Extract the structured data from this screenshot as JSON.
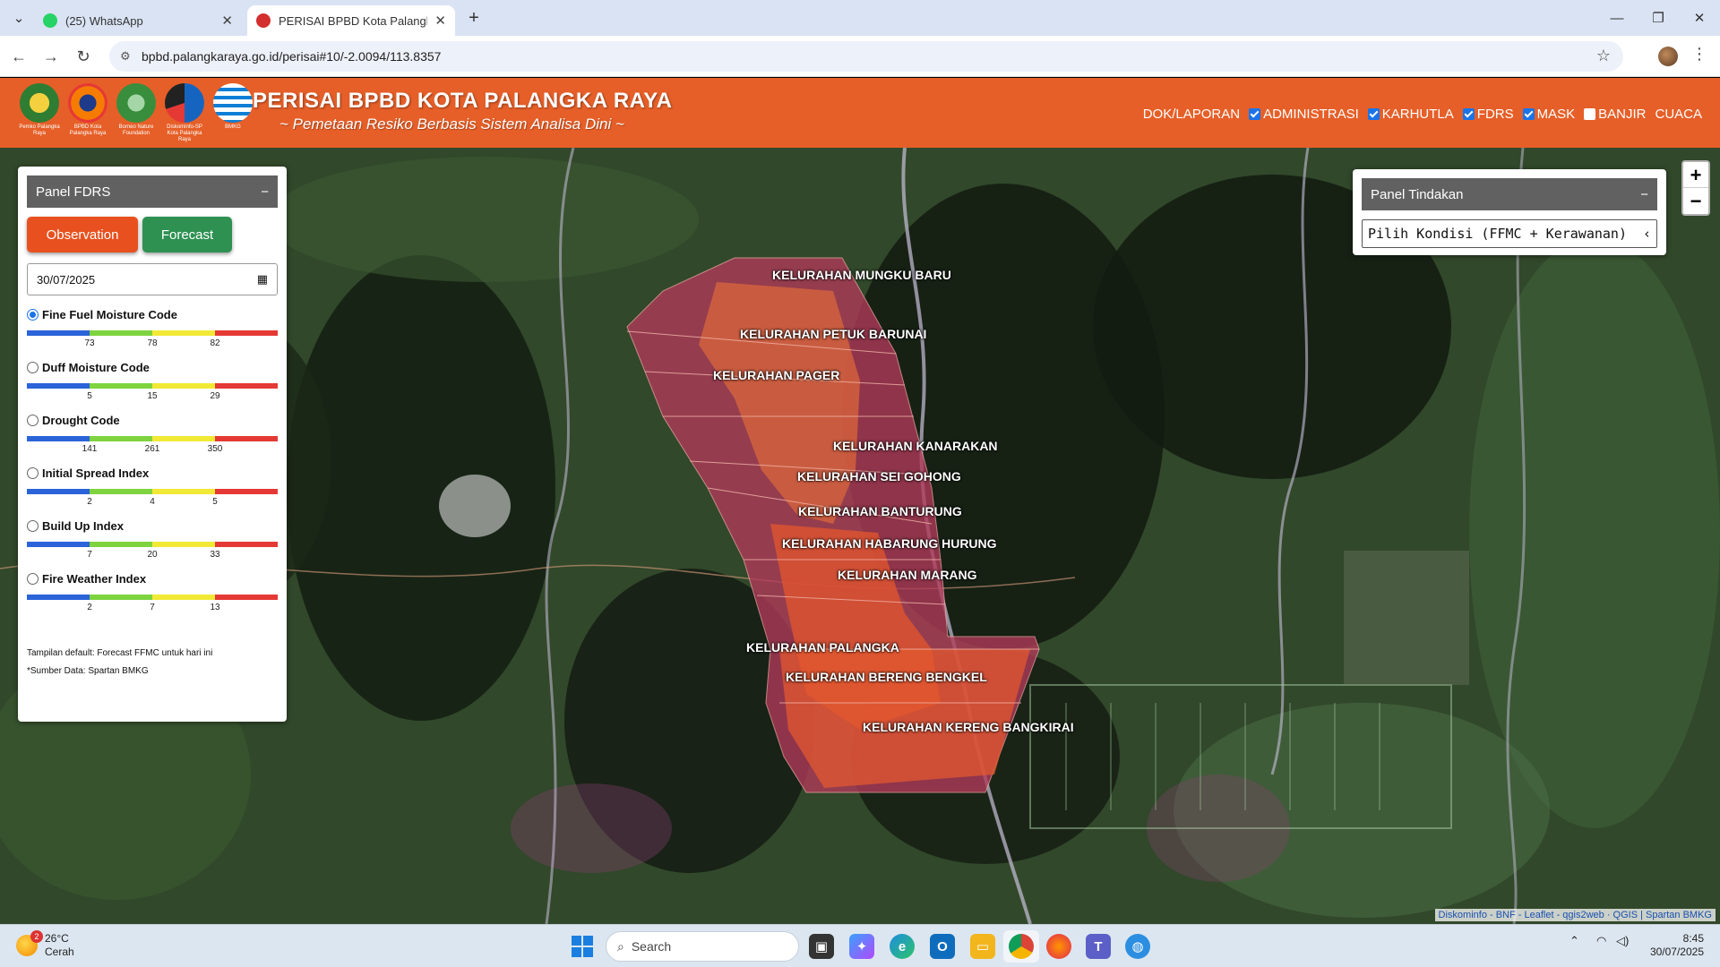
{
  "browser": {
    "tabs": [
      {
        "title": "(25) WhatsApp",
        "active": false
      },
      {
        "title": "PERISAI BPBD Kota Palangka Raya",
        "active": true
      }
    ],
    "url": "bpbd.palangkaraya.go.id/perisai#10/-2.0094/113.8357"
  },
  "header": {
    "logos": [
      {
        "caption": "Pemko Palangka Raya",
        "color": "#2e7d32"
      },
      {
        "caption": "BPBD Kota Palangka Raya",
        "color": "#e53935"
      },
      {
        "caption": "Borneo Nature Foundation",
        "color": "#388e3c"
      },
      {
        "caption": "Diskominfo-SP Kota Palangka Raya",
        "color": "#1565c0"
      },
      {
        "caption": "BMKG",
        "color": "#0d7fd6"
      }
    ],
    "title": "PERISAI BPBD KOTA PALANGKA RAYA",
    "subtitle": "~ Pemetaan Resiko Berbasis Sistem Analisa Dini ~",
    "menu": [
      {
        "label": "DOK/LAPORAN",
        "checkbox": false
      },
      {
        "label": "ADMINISTRASI",
        "checkbox": true,
        "checked": true
      },
      {
        "label": "KARHUTLA",
        "checkbox": true,
        "checked": true
      },
      {
        "label": "FDRS",
        "checkbox": true,
        "checked": true
      },
      {
        "label": "MASK",
        "checkbox": true,
        "checked": true
      },
      {
        "label": "BANJIR",
        "checkbox": true,
        "checked": false
      },
      {
        "label": "CUACA",
        "checkbox": false
      }
    ]
  },
  "panel_fdrs": {
    "title": "Panel FDRS",
    "collapse_label": "−",
    "tab_observation": "Observation",
    "tab_forecast": "Forecast",
    "date_value": "30/07/2025",
    "indices": [
      {
        "label": "Fine Fuel Moisture Code",
        "selected": true,
        "ticks": [
          "73",
          "78",
          "82"
        ]
      },
      {
        "label": "Duff Moisture Code",
        "selected": false,
        "ticks": [
          "5",
          "15",
          "29"
        ]
      },
      {
        "label": "Drought Code",
        "selected": false,
        "ticks": [
          "141",
          "261",
          "350"
        ]
      },
      {
        "label": "Initial Spread Index",
        "selected": false,
        "ticks": [
          "2",
          "4",
          "5"
        ]
      },
      {
        "label": "Build Up Index",
        "selected": false,
        "ticks": [
          "7",
          "20",
          "33"
        ]
      },
      {
        "label": "Fire Weather Index",
        "selected": false,
        "ticks": [
          "2",
          "7",
          "13"
        ]
      }
    ],
    "scale_colors": [
      "#2b63d9",
      "#7ed33f",
      "#f2e937",
      "#e53935"
    ],
    "note_default": "Tampilan default: Forecast FFMC untuk hari ini",
    "note_source": "*Sumber Data: Spartan BMKG"
  },
  "panel_tindakan": {
    "title": "Panel Tindakan",
    "collapse_label": "−",
    "select_value": "Pilih Kondisi (FFMC + Kerawanan)"
  },
  "map": {
    "zoom_in": "+",
    "zoom_out": "−",
    "kelurahan": [
      "KELURAHAN MUNGKU BARU",
      "KELURAHAN PETUK BARUNAI",
      "KELURAHAN PAGER",
      "KELURAHAN KANARAKAN",
      "KELURAHAN SEI GOHONG",
      "KELURAHAN BANTURUNG",
      "KELURAHAN HABARUNG HURUNG",
      "KELURAHAN MARANG",
      "KELURAHAN PALANGKA",
      "KELURAHAN BERENG BENGKEL",
      "KELURAHAN KERENG BANGKIRAI"
    ],
    "attribution": "Diskominfo - BNF - Leaflet - qgis2web · QGIS | Spartan BMKG"
  },
  "taskbar": {
    "weather_temp": "26°C",
    "weather_desc": "Cerah",
    "weather_badge": "2",
    "search_placeholder": "Search",
    "time": "8:45",
    "date": "30/07/2025"
  }
}
